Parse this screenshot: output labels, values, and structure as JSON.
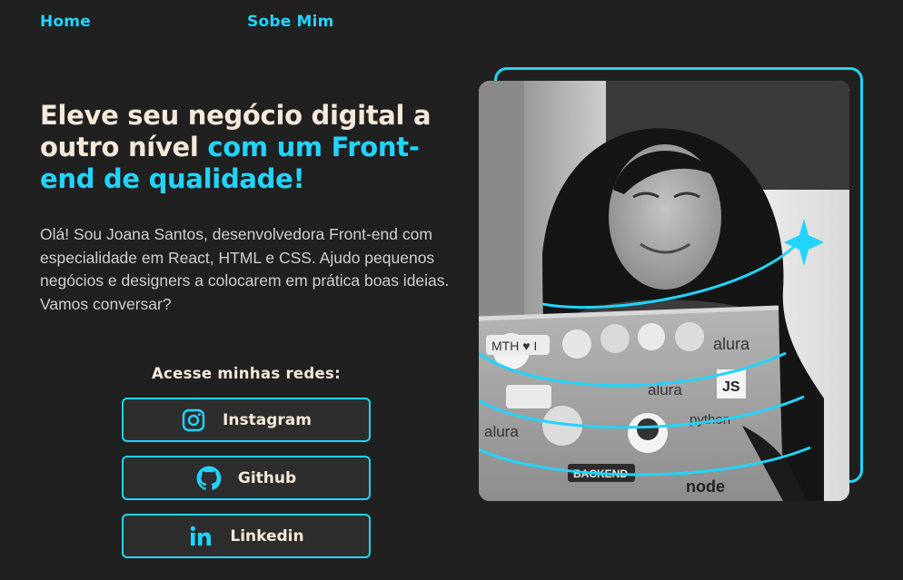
{
  "nav": {
    "home": "Home",
    "about": "Sobe Mim"
  },
  "hero": {
    "headline_part1": "Eleve seu negócio digital a outro nível ",
    "headline_part2": "com um Front-end de qualidade!",
    "intro": "Olá! Sou Joana Santos, desenvolvedora Front-end com especialidade em React, HTML e CSS. Ajudo pequenos negócios e designers a colocarem em prática boas ideias. Vamos conversar?"
  },
  "social": {
    "title": "Acesse minhas redes:",
    "buttons": [
      {
        "label": "Instagram",
        "icon": "instagram-icon"
      },
      {
        "label": "Github",
        "icon": "github-icon"
      },
      {
        "label": "Linkedin",
        "icon": "linkedin-icon"
      }
    ]
  },
  "colors": {
    "background": "#202020",
    "accent": "#22D4FD",
    "cream": "#F6E9D9"
  },
  "laptop_stickers": [
    "alura",
    "MTH ♥ I",
    "JS",
    "alura",
    "python",
    "alura",
    "BACKEND",
    "node"
  ]
}
